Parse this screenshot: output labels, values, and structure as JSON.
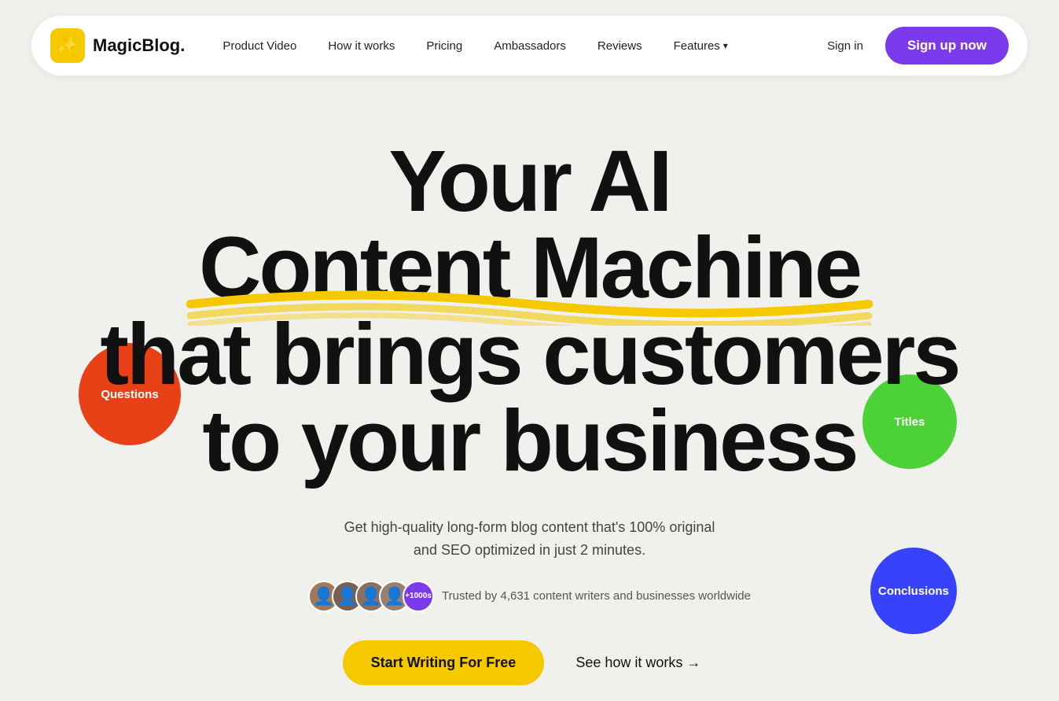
{
  "navbar": {
    "logo_text": "MagicBlog.",
    "logo_icon": "✨",
    "nav_items": [
      {
        "id": "product-video",
        "label": "Product Video"
      },
      {
        "id": "how-it-works",
        "label": "How it works"
      },
      {
        "id": "pricing",
        "label": "Pricing"
      },
      {
        "id": "ambassadors",
        "label": "Ambassadors"
      },
      {
        "id": "reviews",
        "label": "Reviews"
      },
      {
        "id": "features",
        "label": "Features",
        "has_dropdown": true
      }
    ],
    "sign_in_label": "Sign in",
    "sign_up_label": "Sign up now"
  },
  "hero": {
    "title_line1": "Your AI",
    "title_line2": "Content Machine",
    "title_line3": "that brings customers",
    "title_line4": "to your business",
    "subtitle_line1": "Get high-quality long-form blog content that's 100% original",
    "subtitle_line2": "and SEO optimized in just 2 minutes.",
    "social_proof_count": "+1000s",
    "social_proof_text": "Trusted by 4,631 content writers and businesses worldwide",
    "cta_primary": "Start Writing For Free",
    "cta_secondary": "See how it works →"
  },
  "floating_circles": {
    "questions": {
      "label": "Questions",
      "color": "#e84118"
    },
    "titles": {
      "label": "Titles",
      "color": "#4cd137"
    },
    "conclusions": {
      "label": "Conclusions",
      "color": "#3742fa"
    }
  },
  "colors": {
    "bg": "#f0f0ec",
    "navbar_bg": "#ffffff",
    "logo_bg": "#f5c800",
    "sign_up_bg": "#7c3aed",
    "cta_bg": "#f5c800",
    "accent_yellow": "#f5c800"
  }
}
